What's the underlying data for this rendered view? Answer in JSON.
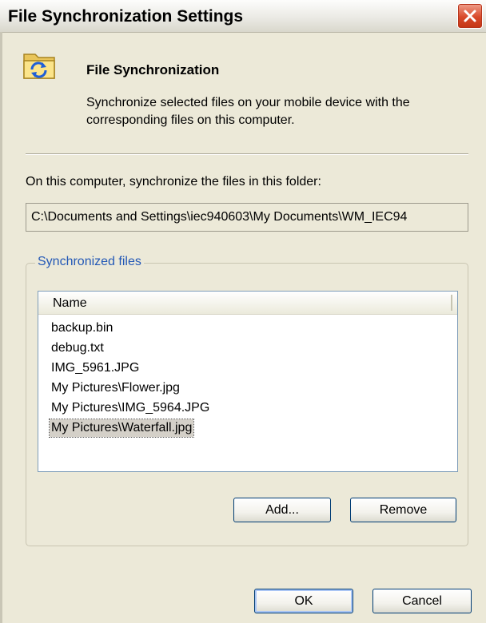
{
  "window": {
    "title": "File Synchronization Settings",
    "close_icon": "close-icon"
  },
  "header": {
    "icon": "folder-sync-icon",
    "title": "File Synchronization",
    "description": "Synchronize selected files on your mobile device with the corresponding files on this computer."
  },
  "folder": {
    "label": "On this computer, synchronize the files in this folder:",
    "path": "C:\\Documents and Settings\\iec940603\\My Documents\\WM_IEC94"
  },
  "synchronized_files": {
    "legend": "Synchronized files",
    "column_header": "Name",
    "items": [
      "backup.bin",
      "debug.txt",
      "IMG_5961.JPG",
      "My Pictures\\Flower.jpg",
      "My Pictures\\IMG_5964.JPG",
      "My Pictures\\Waterfall.jpg"
    ],
    "selected_index": 5
  },
  "buttons": {
    "add": "Add...",
    "remove": "Remove",
    "ok": "OK",
    "cancel": "Cancel"
  },
  "colors": {
    "dialog_background": "#ece9d8",
    "group_legend": "#2358b6",
    "close_button": "#d8492a"
  }
}
